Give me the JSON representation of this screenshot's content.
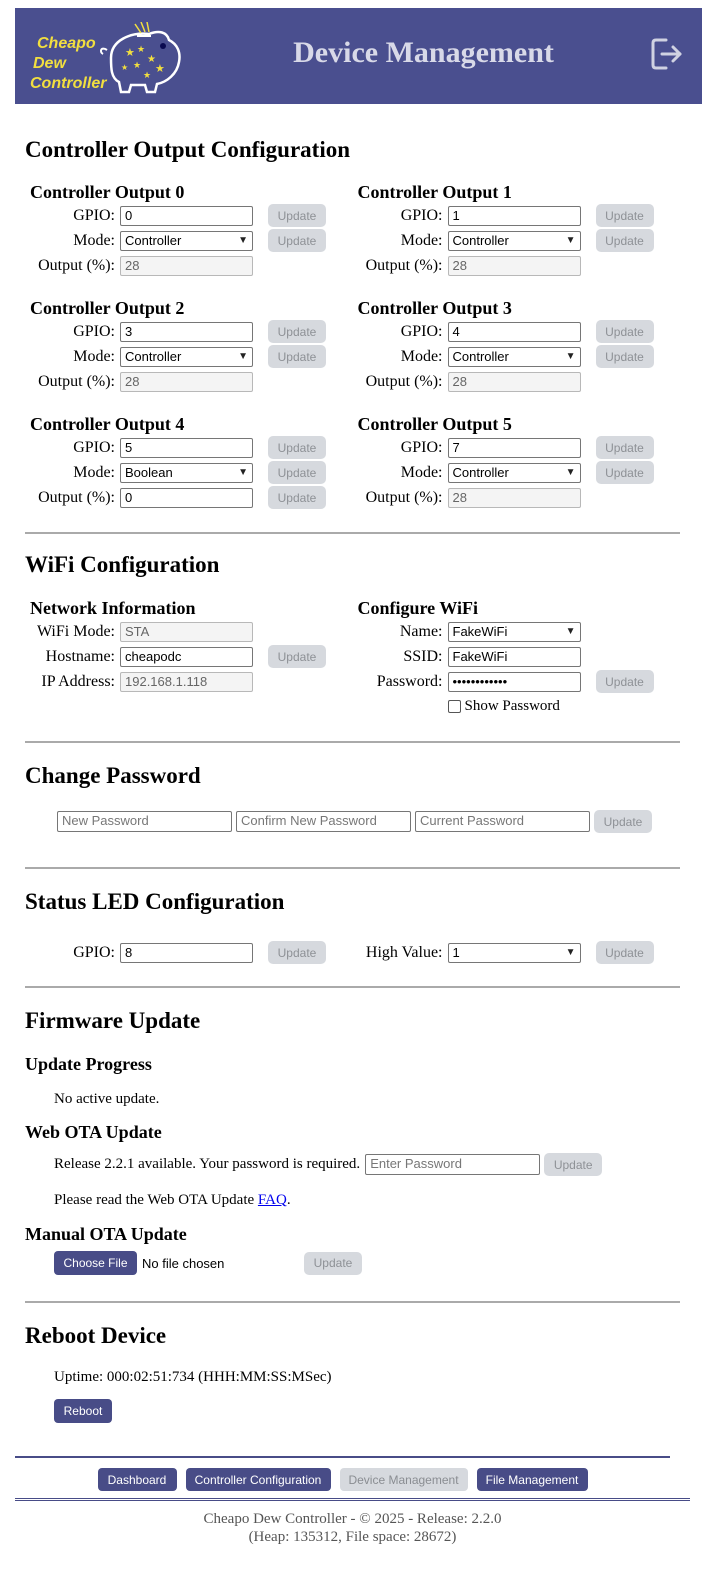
{
  "header": {
    "logo_line1": "Cheapo",
    "logo_line2": "Dew",
    "logo_line3": "Controller",
    "title": "Device Management",
    "logout_icon": "logout-icon"
  },
  "outputs_section": {
    "title": "Controller Output Configuration",
    "gpio_label": "GPIO:",
    "mode_label": "Mode:",
    "output_label": "Output (%):",
    "update_label": "Update",
    "outputs": [
      {
        "title": "Controller Output 0",
        "gpio": "0",
        "mode": "Controller",
        "output": "28"
      },
      {
        "title": "Controller Output 1",
        "gpio": "1",
        "mode": "Controller",
        "output": "28"
      },
      {
        "title": "Controller Output 2",
        "gpio": "3",
        "mode": "Controller",
        "output": "28"
      },
      {
        "title": "Controller Output 3",
        "gpio": "4",
        "mode": "Controller",
        "output": "28"
      },
      {
        "title": "Controller Output 4",
        "gpio": "5",
        "mode": "Boolean",
        "output": "0"
      },
      {
        "title": "Controller Output 5",
        "gpio": "7",
        "mode": "Controller",
        "output": "28"
      }
    ]
  },
  "wifi": {
    "title": "WiFi Configuration",
    "network_title": "Network Information",
    "mode_label": "WiFi Mode:",
    "mode_value": "STA",
    "hostname_label": "Hostname:",
    "hostname_value": "cheapodc",
    "ip_label": "IP Address:",
    "ip_value": "192.168.1.118",
    "configure_title": "Configure WiFi",
    "name_label": "Name:",
    "name_value": "FakeWiFi",
    "ssid_label": "SSID:",
    "ssid_value": "FakeWiFi",
    "password_label": "Password:",
    "password_value": "••••••••••••",
    "show_password_label": "Show Password",
    "show_password_checked": false,
    "update_label": "Update"
  },
  "change_password": {
    "title": "Change Password",
    "new_placeholder": "New Password",
    "confirm_placeholder": "Confirm New Password",
    "current_placeholder": "Current Password",
    "update_label": "Update"
  },
  "status_led": {
    "title": "Status LED Configuration",
    "gpio_label": "GPIO:",
    "gpio_value": "8",
    "high_label": "High Value:",
    "high_value": "1",
    "update_label": "Update"
  },
  "firmware": {
    "title": "Firmware Update",
    "progress_title": "Update Progress",
    "progress_text": "No active update.",
    "web_ota_title": "Web OTA Update",
    "release_text": "Release 2.2.1 available. Your password is required.",
    "password_placeholder": "Enter Password",
    "update_label": "Update",
    "faq_prefix": "Please read the Web OTA Update ",
    "faq_link": "FAQ",
    "faq_suffix": ".",
    "manual_title": "Manual OTA Update",
    "choose_file_label": "Choose File",
    "no_file_text": "No file chosen"
  },
  "reboot": {
    "title": "Reboot Device",
    "uptime_text": "Uptime: 000:02:51:734 (HHH:MM:SS:MSec)",
    "reboot_label": "Reboot"
  },
  "nav": {
    "dashboard": "Dashboard",
    "controller_config": "Controller Configuration",
    "device_management": "Device Management",
    "file_management": "File Management"
  },
  "footer": {
    "line1": "Cheapo Dew Controller - © 2025 - Release: 2.2.0",
    "line2": "(Heap: 135312, File space: 28672)"
  },
  "colors": {
    "banner": "#4a4f8f",
    "accent": "#484c87",
    "logo_yellow": "#f2df3f",
    "disabled_button": "#d6d9de"
  }
}
